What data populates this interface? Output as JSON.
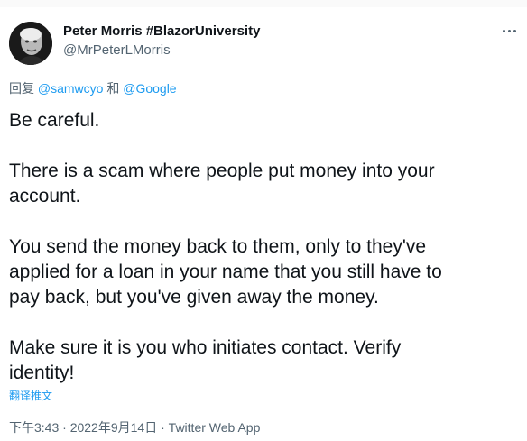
{
  "user": {
    "display_name": "Peter Morris #BlazorUniversity",
    "handle": "@MrPeterLMorris",
    "avatar_icon": "profile-photo"
  },
  "more_icon": "ellipsis-icon",
  "reply": {
    "prefix": "回复 ",
    "mention1": "@samwcyo",
    "connector": " 和 ",
    "mention2": "@Google"
  },
  "tweet": {
    "lines": [
      "Be careful.",
      "",
      "There is a scam where people put money into your",
      "account.",
      "",
      "You send the money back to them, only to they've",
      "applied for a loan in your name that you still have to",
      "pay back, but you've given away the money.",
      "",
      "Make sure it is you who initiates contact. Verify",
      "identity!"
    ]
  },
  "translate_label": "翻译推文",
  "meta": {
    "time": "下午3:43",
    "separator": " · ",
    "date": "2022年9月14日",
    "source": "Twitter Web App"
  },
  "colors": {
    "text": "#0f1419",
    "secondary": "#536471",
    "link": "#1d9bf0"
  }
}
